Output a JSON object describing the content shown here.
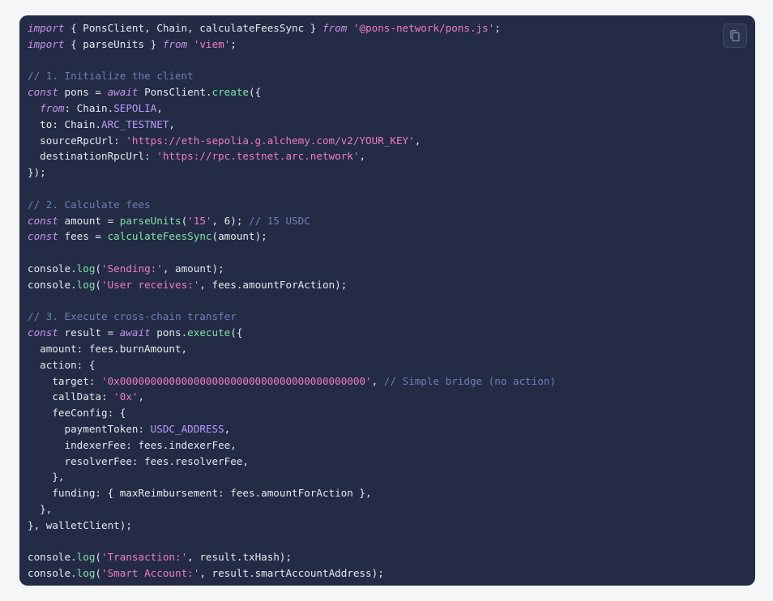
{
  "copy_button": {
    "icon": "copy-icon"
  },
  "code_lines": [
    [
      [
        "kw",
        "import"
      ],
      [
        "plain",
        " { PonsClient, Chain, calculateFeesSync } "
      ],
      [
        "kw",
        "from"
      ],
      [
        "plain",
        " "
      ],
      [
        "str",
        "'@pons-network/pons.js'"
      ],
      [
        "plain",
        ";"
      ]
    ],
    [
      [
        "kw",
        "import"
      ],
      [
        "plain",
        " { parseUnits } "
      ],
      [
        "kw",
        "from"
      ],
      [
        "plain",
        " "
      ],
      [
        "str",
        "'viem'"
      ],
      [
        "plain",
        ";"
      ]
    ],
    [],
    [
      [
        "cm",
        "// 1. Initialize the client"
      ]
    ],
    [
      [
        "kw",
        "const"
      ],
      [
        "plain",
        " pons = "
      ],
      [
        "kw",
        "await"
      ],
      [
        "plain",
        " PonsClient."
      ],
      [
        "fn",
        "create"
      ],
      [
        "plain",
        "({"
      ]
    ],
    [
      [
        "plain",
        "  "
      ],
      [
        "kw",
        "from"
      ],
      [
        "plain",
        ": Chain."
      ],
      [
        "enum",
        "SEPOLIA"
      ],
      [
        "plain",
        ","
      ]
    ],
    [
      [
        "plain",
        "  to: Chain."
      ],
      [
        "enum",
        "ARC_TESTNET"
      ],
      [
        "plain",
        ","
      ]
    ],
    [
      [
        "plain",
        "  sourceRpcUrl: "
      ],
      [
        "str",
        "'https://eth-sepolia.g.alchemy.com/v2/YOUR_KEY'"
      ],
      [
        "plain",
        ","
      ]
    ],
    [
      [
        "plain",
        "  destinationRpcUrl: "
      ],
      [
        "str",
        "'https://rpc.testnet.arc.network'"
      ],
      [
        "plain",
        ","
      ]
    ],
    [
      [
        "plain",
        "});"
      ]
    ],
    [],
    [
      [
        "cm",
        "// 2. Calculate fees"
      ]
    ],
    [
      [
        "kw",
        "const"
      ],
      [
        "plain",
        " amount = "
      ],
      [
        "fn",
        "parseUnits"
      ],
      [
        "plain",
        "("
      ],
      [
        "str",
        "'15'"
      ],
      [
        "plain",
        ", 6); "
      ],
      [
        "cm",
        "// 15 USDC"
      ]
    ],
    [
      [
        "kw",
        "const"
      ],
      [
        "plain",
        " fees = "
      ],
      [
        "fn",
        "calculateFeesSync"
      ],
      [
        "plain",
        "(amount);"
      ]
    ],
    [],
    [
      [
        "plain",
        "console."
      ],
      [
        "fn",
        "log"
      ],
      [
        "plain",
        "("
      ],
      [
        "str",
        "'Sending:'"
      ],
      [
        "plain",
        ", amount);"
      ]
    ],
    [
      [
        "plain",
        "console."
      ],
      [
        "fn",
        "log"
      ],
      [
        "plain",
        "("
      ],
      [
        "str",
        "'User receives:'"
      ],
      [
        "plain",
        ", fees.amountForAction);"
      ]
    ],
    [],
    [
      [
        "cm",
        "// 3. Execute cross-chain transfer"
      ]
    ],
    [
      [
        "kw",
        "const"
      ],
      [
        "plain",
        " result = "
      ],
      [
        "kw",
        "await"
      ],
      [
        "plain",
        " pons."
      ],
      [
        "fn",
        "execute"
      ],
      [
        "plain",
        "({"
      ]
    ],
    [
      [
        "plain",
        "  amount: fees.burnAmount,"
      ]
    ],
    [
      [
        "plain",
        "  action: {"
      ]
    ],
    [
      [
        "plain",
        "    target: "
      ],
      [
        "str",
        "'0x0000000000000000000000000000000000000000'"
      ],
      [
        "plain",
        ", "
      ],
      [
        "cm",
        "// Simple bridge (no action)"
      ]
    ],
    [
      [
        "plain",
        "    callData: "
      ],
      [
        "str",
        "'0x'"
      ],
      [
        "plain",
        ","
      ]
    ],
    [
      [
        "plain",
        "    feeConfig: {"
      ]
    ],
    [
      [
        "plain",
        "      paymentToken: "
      ],
      [
        "enum",
        "USDC_ADDRESS"
      ],
      [
        "plain",
        ","
      ]
    ],
    [
      [
        "plain",
        "      indexerFee: fees.indexerFee,"
      ]
    ],
    [
      [
        "plain",
        "      resolverFee: fees.resolverFee,"
      ]
    ],
    [
      [
        "plain",
        "    },"
      ]
    ],
    [
      [
        "plain",
        "    funding: { maxReimbursement: fees.amountForAction },"
      ]
    ],
    [
      [
        "plain",
        "  },"
      ]
    ],
    [
      [
        "plain",
        "}, walletClient);"
      ]
    ],
    [],
    [
      [
        "plain",
        "console."
      ],
      [
        "fn",
        "log"
      ],
      [
        "plain",
        "("
      ],
      [
        "str",
        "'Transaction:'"
      ],
      [
        "plain",
        ", result.txHash);"
      ]
    ],
    [
      [
        "plain",
        "console."
      ],
      [
        "fn",
        "log"
      ],
      [
        "plain",
        "("
      ],
      [
        "str",
        "'Smart Account:'"
      ],
      [
        "plain",
        ", result.smartAccountAddress);"
      ]
    ]
  ]
}
